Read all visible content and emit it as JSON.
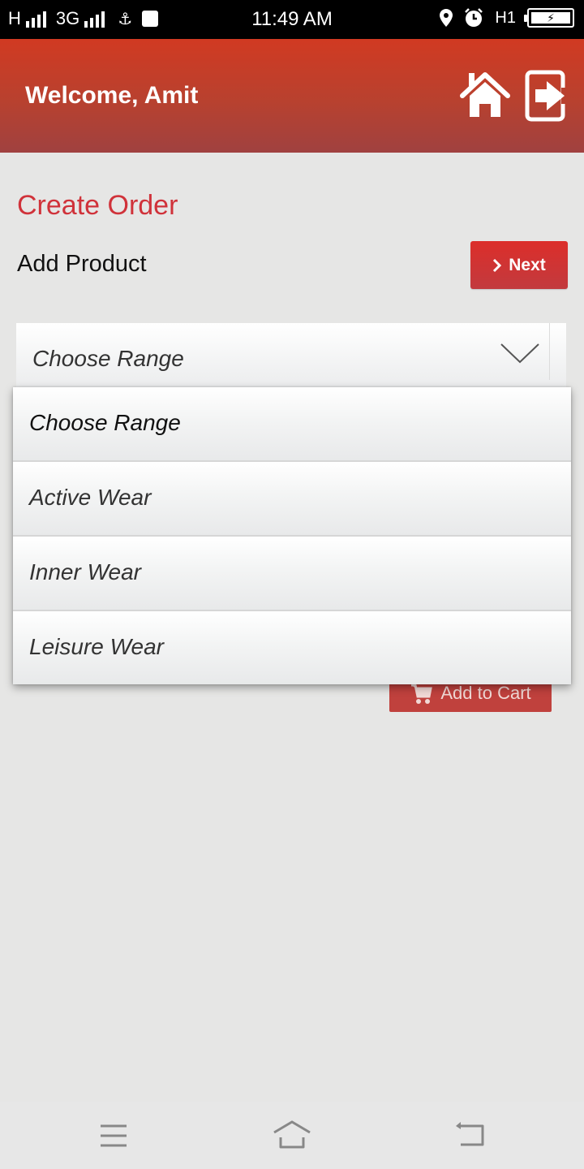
{
  "status_bar": {
    "network_left": "H",
    "network_mid": "3G",
    "time": "11:49 AM",
    "network_right": "H1",
    "icons": [
      "signal-icon",
      "signal-icon",
      "usb-icon",
      "usb-debug-icon",
      "location-icon",
      "alarm-icon",
      "battery-charging-icon"
    ]
  },
  "header": {
    "welcome": "Welcome, Amit",
    "home_icon": "home-icon",
    "logout_icon": "logout-icon"
  },
  "page": {
    "title": "Create Order",
    "subtitle": "Add Product",
    "next_label": "Next",
    "add_to_cart_label": "Add to Cart"
  },
  "range_select": {
    "selected": "Choose Range",
    "options": [
      "Choose Range",
      "Active Wear",
      "Inner Wear",
      "Leisure Wear"
    ]
  },
  "colors": {
    "accent": "#d0323a",
    "header": "#c03a2a",
    "button": "#c23a3e"
  },
  "nav_bar": {
    "icons": [
      "menu-icon",
      "home-icon",
      "back-icon"
    ]
  }
}
